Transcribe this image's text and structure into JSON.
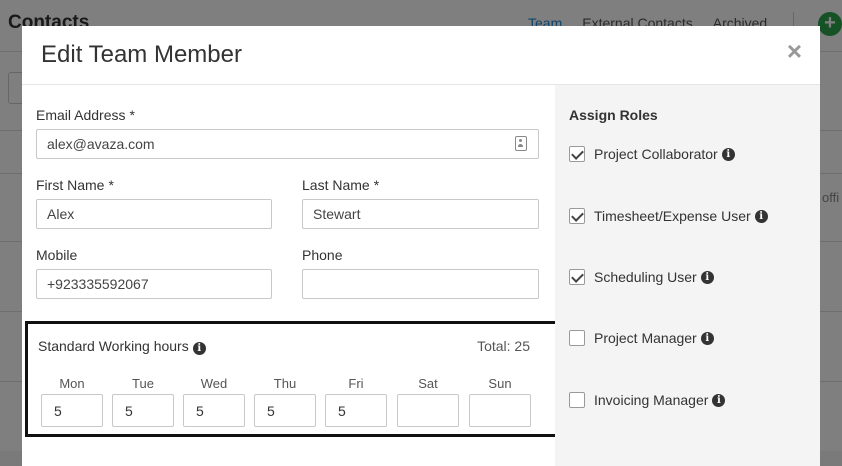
{
  "background": {
    "page_title": "Contacts",
    "tabs": [
      "Team",
      "External Contacts",
      "Archived"
    ],
    "add_button": "+",
    "side_text": "offi"
  },
  "modal": {
    "title": "Edit Team Member",
    "close_label": "×",
    "form": {
      "email": {
        "label": "Email Address",
        "required_mark": "*",
        "value": "alex@avaza.com"
      },
      "first_name": {
        "label": "First Name",
        "required_mark": "*",
        "value": "Alex"
      },
      "last_name": {
        "label": "Last Name",
        "required_mark": "*",
        "value": "Stewart"
      },
      "mobile": {
        "label": "Mobile",
        "value": "+923335592067"
      },
      "phone": {
        "label": "Phone",
        "value": ""
      }
    },
    "working_hours": {
      "label": "Standard Working hours",
      "total": "Total: 25",
      "days": [
        {
          "label": "Mon",
          "value": "5"
        },
        {
          "label": "Tue",
          "value": "5"
        },
        {
          "label": "Wed",
          "value": "5"
        },
        {
          "label": "Thu",
          "value": "5"
        },
        {
          "label": "Fri",
          "value": "5"
        },
        {
          "label": "Sat",
          "value": ""
        },
        {
          "label": "Sun",
          "value": ""
        }
      ]
    },
    "roles": {
      "title": "Assign Roles",
      "items": [
        {
          "label": "Project Collaborator",
          "checked": true
        },
        {
          "label": "Timesheet/Expense User",
          "checked": true
        },
        {
          "label": "Scheduling User",
          "checked": true
        },
        {
          "label": "Project Manager",
          "checked": false
        },
        {
          "label": "Invoicing Manager",
          "checked": false
        }
      ]
    },
    "info_glyph": "i"
  },
  "colors": {
    "accent": "#1e88d2",
    "add_button": "#2ea44f",
    "overlay": "#7a7a7a"
  }
}
